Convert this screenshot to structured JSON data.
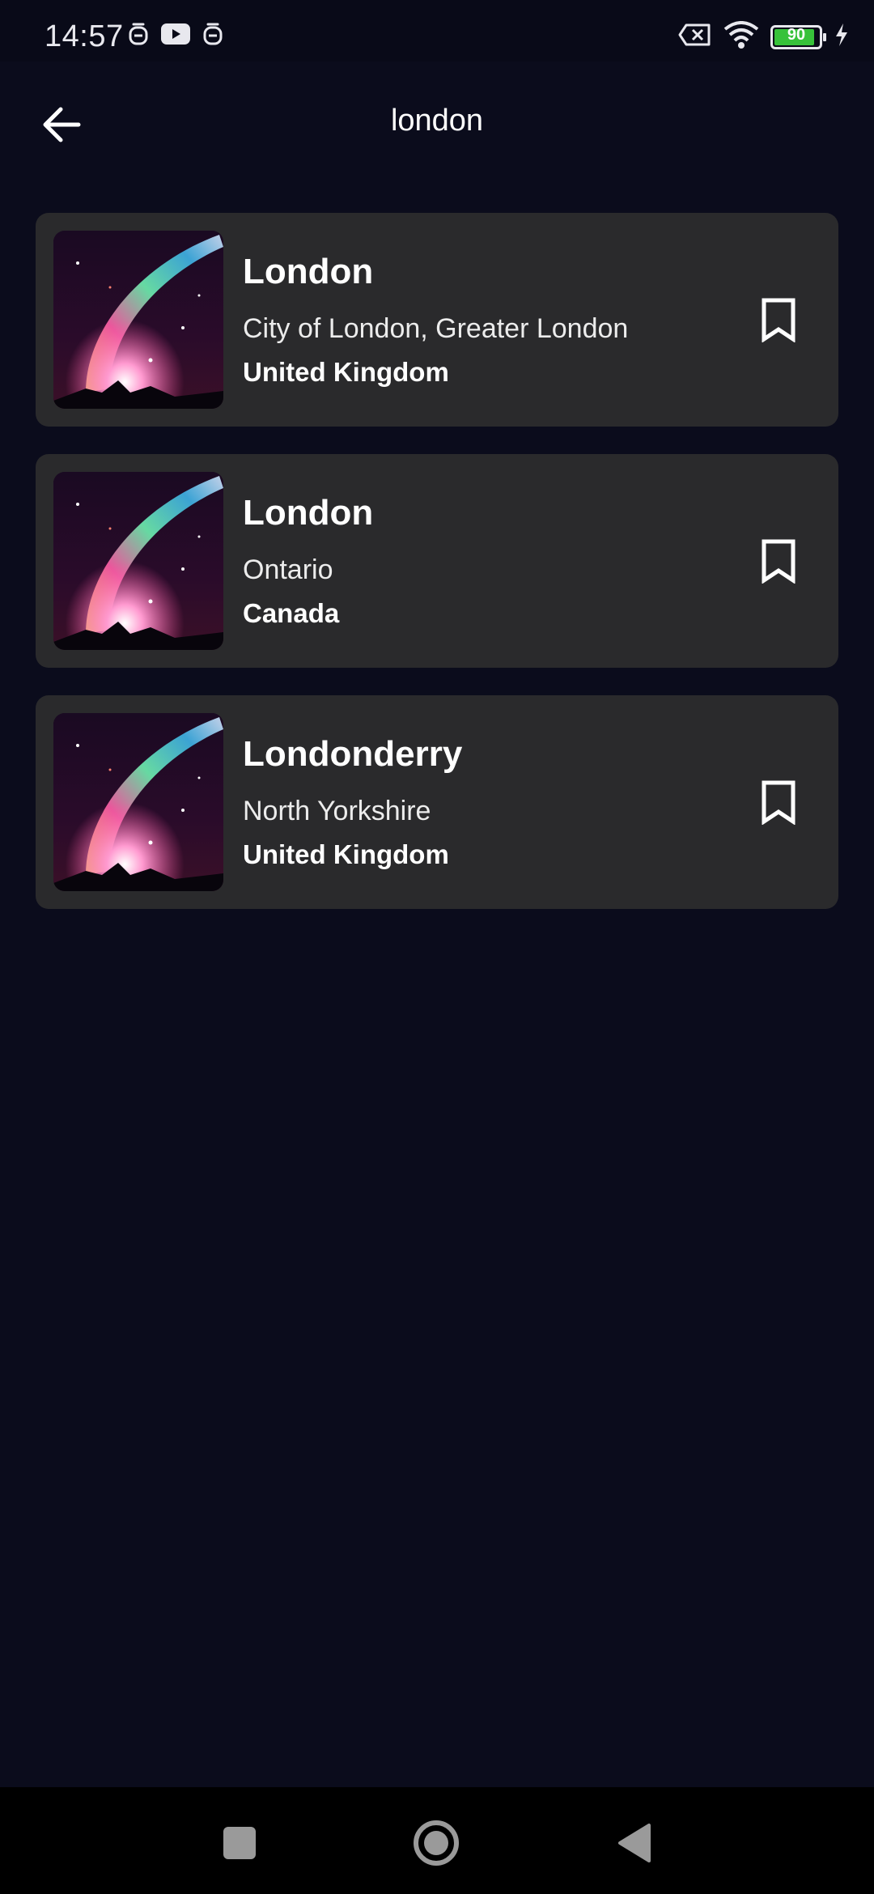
{
  "status_bar": {
    "time": "14:57",
    "battery_level": "90",
    "left_icons": [
      "notification-icon",
      "youtube-icon",
      "notification-icon"
    ],
    "right_icons": [
      "no-sim-icon",
      "wifi-icon",
      "battery-icon",
      "charging-icon"
    ]
  },
  "app_bar": {
    "title": "london",
    "back_icon": "arrow-left-icon"
  },
  "results": [
    {
      "name": "London",
      "region": "City of London, Greater London",
      "country": "United Kingdom",
      "bookmark_icon": "bookmark-outline-icon"
    },
    {
      "name": "London",
      "region": "Ontario",
      "country": "Canada",
      "bookmark_icon": "bookmark-outline-icon"
    },
    {
      "name": "Londonderry",
      "region": "North Yorkshire",
      "country": "United Kingdom",
      "bookmark_icon": "bookmark-outline-icon"
    }
  ],
  "nav_bar": {
    "buttons": [
      "recents-icon",
      "home-icon",
      "back-triangle-icon"
    ]
  },
  "colors": {
    "background": "#0b0c1c",
    "card": "#2a2a2c",
    "text": "#ffffff",
    "battery": "#37c23a"
  }
}
